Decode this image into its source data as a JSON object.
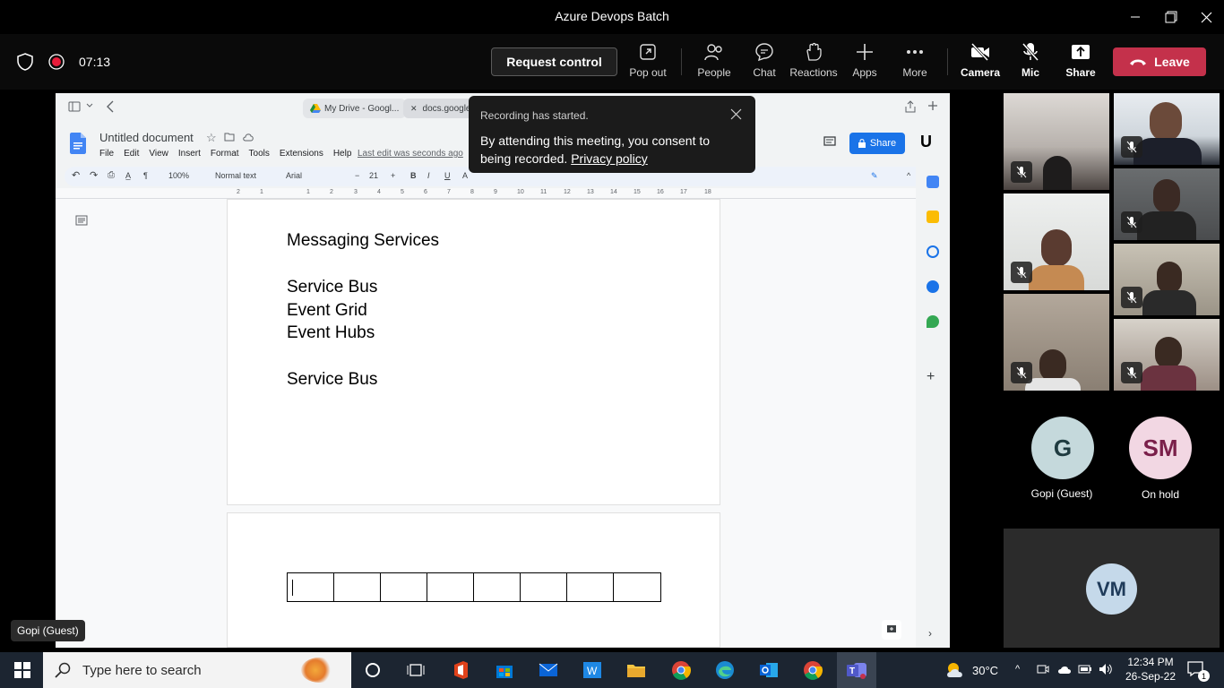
{
  "window": {
    "title": "Azure Devops Batch"
  },
  "meeting": {
    "timer": "07:13",
    "request_control_label": "Request control",
    "toolbar_items": [
      {
        "label": "Pop out",
        "icon": "pop-out-icon"
      },
      {
        "label": "People",
        "icon": "people-icon"
      },
      {
        "label": "Chat",
        "icon": "chat-icon"
      },
      {
        "label": "Reactions",
        "icon": "reactions-icon"
      },
      {
        "label": "Apps",
        "icon": "plus-icon"
      },
      {
        "label": "More",
        "icon": "more-icon"
      },
      {
        "label": "Camera",
        "icon": "camera-off-icon"
      },
      {
        "label": "Mic",
        "icon": "mic-off-icon"
      },
      {
        "label": "Share",
        "icon": "share-icon"
      }
    ],
    "leave_label": "Leave",
    "leave_color": "#c4314b"
  },
  "toast": {
    "title": "Recording has started.",
    "message": "By attending this meeting, you consent to being recorded.",
    "link": "Privacy policy"
  },
  "browser": {
    "tabs": [
      {
        "label": "My Drive - Googl..."
      },
      {
        "label": "docs.google..."
      }
    ]
  },
  "docs": {
    "title": "Untitled document",
    "menu": [
      "File",
      "Edit",
      "View",
      "Insert",
      "Format",
      "Tools",
      "Extensions",
      "Help"
    ],
    "last_edit": "Last edit was seconds ago",
    "share_label": "Share",
    "toolbar": {
      "zoom": "100%",
      "style": "Normal text",
      "font": "Arial",
      "font_size": "21"
    },
    "ruler_ticks": [
      "2",
      "1",
      "1",
      "2",
      "3",
      "4",
      "5",
      "6",
      "7",
      "8",
      "9",
      "10",
      "11",
      "12",
      "13",
      "14",
      "15",
      "16",
      "17",
      "18"
    ],
    "content_lines": [
      "Messaging Services",
      "Service Bus",
      "Event Grid",
      "Event Hubs",
      "Service Bus"
    ],
    "accent_color": "#1a73e8"
  },
  "participants": {
    "avatars": [
      {
        "initials": "G",
        "name": "Gopi (Guest)"
      },
      {
        "initials": "SM",
        "name": "On hold"
      },
      {
        "initials": "VM",
        "name": ""
      }
    ],
    "screen_share_label": "Gopi (Guest)"
  },
  "taskbar": {
    "search_placeholder": "Type here to search",
    "temperature": "30°C",
    "time": "12:34 PM",
    "date": "26-Sep-22",
    "notification_count": "1"
  }
}
